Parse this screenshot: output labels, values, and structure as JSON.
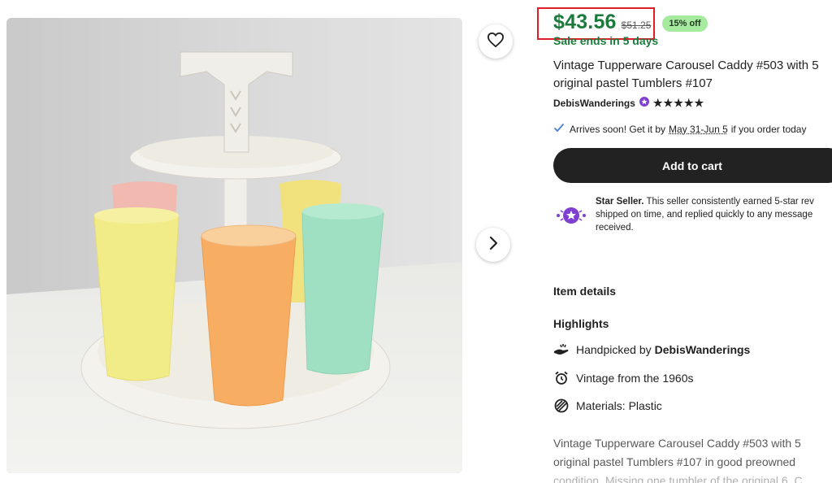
{
  "listing": {
    "price": "$43.56",
    "original_price": "$51.25",
    "discount": "15% off",
    "sale_ends": "Sale ends in 5 days",
    "title": "Vintage Tupperware Carousel Caddy #503 with 5 original pastel Tumblers #107",
    "shop_name": "DebisWanderings",
    "rating_stars": "★★★★★"
  },
  "shipping": {
    "arrives_prefix": "Arrives soon! Get it by",
    "dates": "May 31-Jun 5",
    "arrives_suffix": "if you order today"
  },
  "actions": {
    "add_to_cart": "Add to cart"
  },
  "star_seller": {
    "heading": "Star Seller.",
    "line1": "This seller consistently earned 5-star rev",
    "line2": "shipped on time, and replied quickly to any message",
    "line3": "received."
  },
  "details": {
    "item_details": "Item details",
    "highlights": "Highlights",
    "handpicked_prefix": "Handpicked by",
    "handpicked_shop": "DebisWanderings",
    "vintage": "Vintage from the 1960s",
    "materials": "Materials: Plastic"
  },
  "description": {
    "line1": "Vintage Tupperware Carousel Caddy #503 with 5",
    "line2": "original pastel Tumblers #107 in good preowned",
    "line3": "condition. Missing one tumbler of the original 6. C"
  },
  "icons": {
    "favorite": "heart-icon",
    "next": "chevron-right-icon",
    "check": "check-icon",
    "badge": "star-seller-badge-icon",
    "hand": "hand-icon",
    "clock": "alarm-clock-icon",
    "materials": "materials-icon"
  },
  "colors": {
    "price_green": "#1c7a3c",
    "discount_bg": "#a5ea9f",
    "highlight_box": "#e11d2a",
    "cart_button": "#222222",
    "star_seller_purple": "#7f3fd1"
  }
}
